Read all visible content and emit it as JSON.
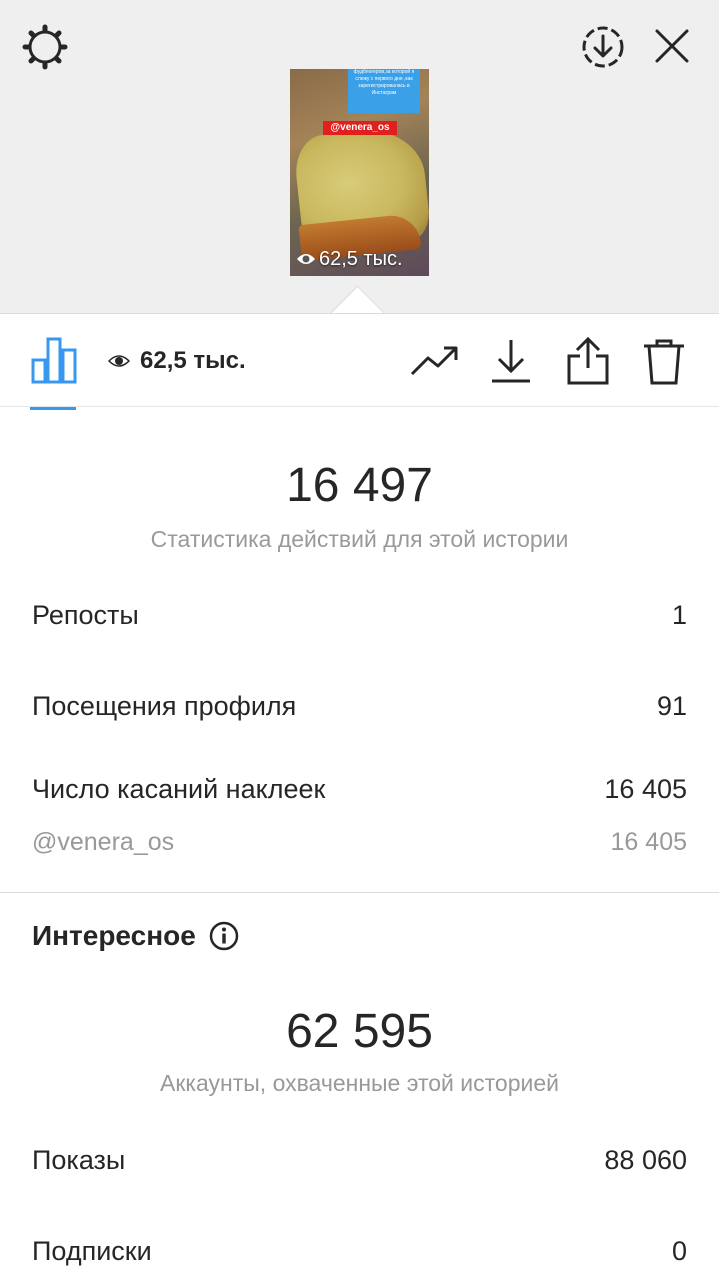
{
  "header": {
    "settings_icon": "gear-icon",
    "download_icon": "download-circle-icon",
    "close_icon": "close-icon"
  },
  "story": {
    "caption": "фудблогеров,за которой я слежу с первого дня ,как зарегистрировалась в Инстаграм",
    "tag": "@venera_os",
    "views": "62,5 тыс."
  },
  "toolbar": {
    "views": "62,5 тыс."
  },
  "interactions": {
    "total": "16 497",
    "subtitle": "Статистика действий для этой истории",
    "rows": [
      {
        "label": "Репосты",
        "value": "1"
      },
      {
        "label": "Посещения профиля",
        "value": "91"
      },
      {
        "label": "Число касаний наклеек",
        "value": "16 405"
      }
    ],
    "sticker": {
      "label": "@venera_os",
      "value": "16 405"
    }
  },
  "discovery": {
    "title": "Интересное",
    "total": "62 595",
    "subtitle": "Аккаунты, охваченные этой историей",
    "rows": [
      {
        "label": "Показы",
        "value": "88 060"
      },
      {
        "label": "Подписки",
        "value": "0"
      }
    ]
  },
  "colors": {
    "accent": "#3897f0",
    "top_background": "#efefef",
    "muted_text": "#999999"
  }
}
